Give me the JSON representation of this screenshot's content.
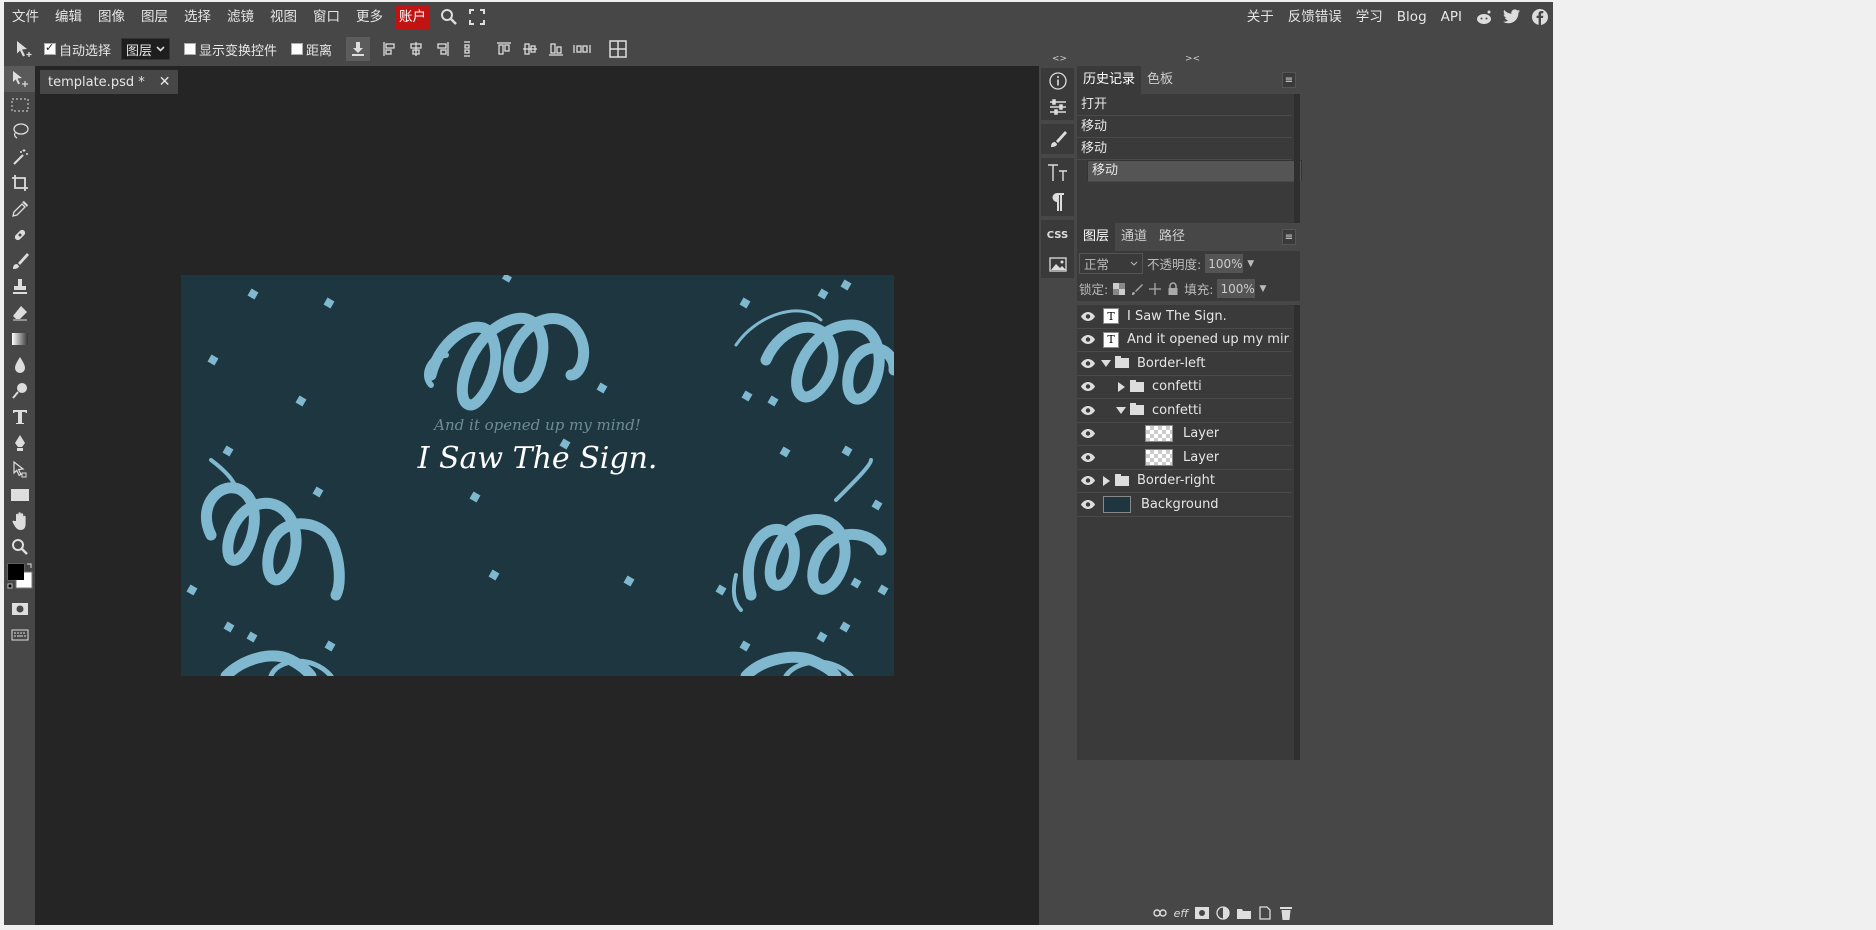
{
  "menu": {
    "items": [
      "文件",
      "编辑",
      "图像",
      "图层",
      "选择",
      "滤镜",
      "视图",
      "窗口",
      "更多"
    ],
    "account": "账户",
    "right_items": [
      "关于",
      "反馈错误",
      "学习",
      "Blog",
      "API"
    ]
  },
  "options": {
    "auto_select": "自动选择",
    "auto_select_checked": true,
    "target": "图层",
    "show_transform": "显示变换控件",
    "distance": "距离"
  },
  "document": {
    "tab_name": "template.psd *",
    "close": "✕"
  },
  "canvas_art": {
    "subtitle": "And it opened up my mind!",
    "title": "I Saw The Sign.",
    "bg_color": "#1d3640",
    "accent_color": "#7fb8cf"
  },
  "history": {
    "tabs": [
      "历史记录",
      "色板"
    ],
    "menu_icon": "≡",
    "items": [
      "打开",
      "移动",
      "移动",
      "移动"
    ],
    "selected_index": 3
  },
  "layers": {
    "tabs": [
      "图层",
      "通道",
      "路径"
    ],
    "menu_icon": "≡",
    "blend_mode": "正常",
    "opacity_label": "不透明度:",
    "opacity_value": "100%",
    "lock_label": "锁定:",
    "fill_label": "填充:",
    "fill_value": "100%",
    "rows": [
      {
        "name": "I Saw The Sign.",
        "kind": "text",
        "indent": 0,
        "toggle": ""
      },
      {
        "name": "And it opened up my mir",
        "kind": "text",
        "indent": 0,
        "toggle": ""
      },
      {
        "name": "Border-left",
        "kind": "folder",
        "indent": 0,
        "toggle": "open"
      },
      {
        "name": "confetti",
        "kind": "folder",
        "indent": 1,
        "toggle": "closed"
      },
      {
        "name": "confetti",
        "kind": "folder",
        "indent": 1,
        "toggle": "open"
      },
      {
        "name": "Layer",
        "kind": "image",
        "indent": 2,
        "toggle": ""
      },
      {
        "name": "Layer",
        "kind": "image",
        "indent": 2,
        "toggle": ""
      },
      {
        "name": "Border-right",
        "kind": "folder",
        "indent": 0,
        "toggle": "closed"
      },
      {
        "name": "Background",
        "kind": "bg",
        "indent": 0,
        "toggle": ""
      }
    ],
    "bottom_icons": [
      "link-icon",
      "effects-icon",
      "mask-icon",
      "adjustment-icon",
      "folder-icon",
      "new-layer-icon",
      "trash-icon"
    ],
    "effects_label": "eff"
  }
}
